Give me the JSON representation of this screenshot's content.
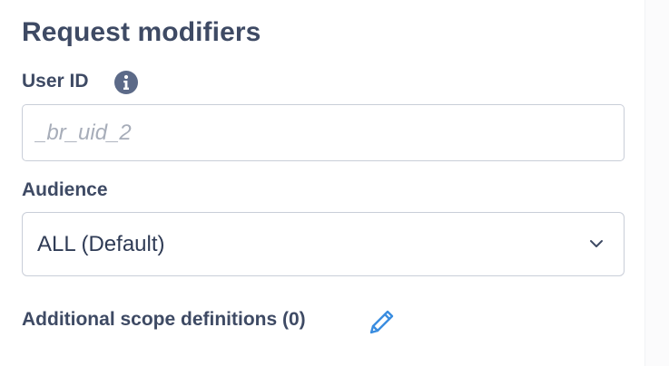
{
  "section": {
    "title": "Request modifiers"
  },
  "user_id": {
    "label": "User ID",
    "info_icon": "info-icon",
    "placeholder": "_br_uid_2",
    "value": ""
  },
  "audience": {
    "label": "Audience",
    "selected": "ALL (Default)",
    "chevron_icon": "chevron-down-icon"
  },
  "scope": {
    "label": "Additional scope definitions (0)",
    "edit_icon": "pencil-icon"
  },
  "colors": {
    "text": "#3e4a64",
    "placeholder": "#a7adb9",
    "border": "#c9ced8",
    "info_icon": "#5c6a88",
    "edit_icon": "#3a8de0"
  }
}
